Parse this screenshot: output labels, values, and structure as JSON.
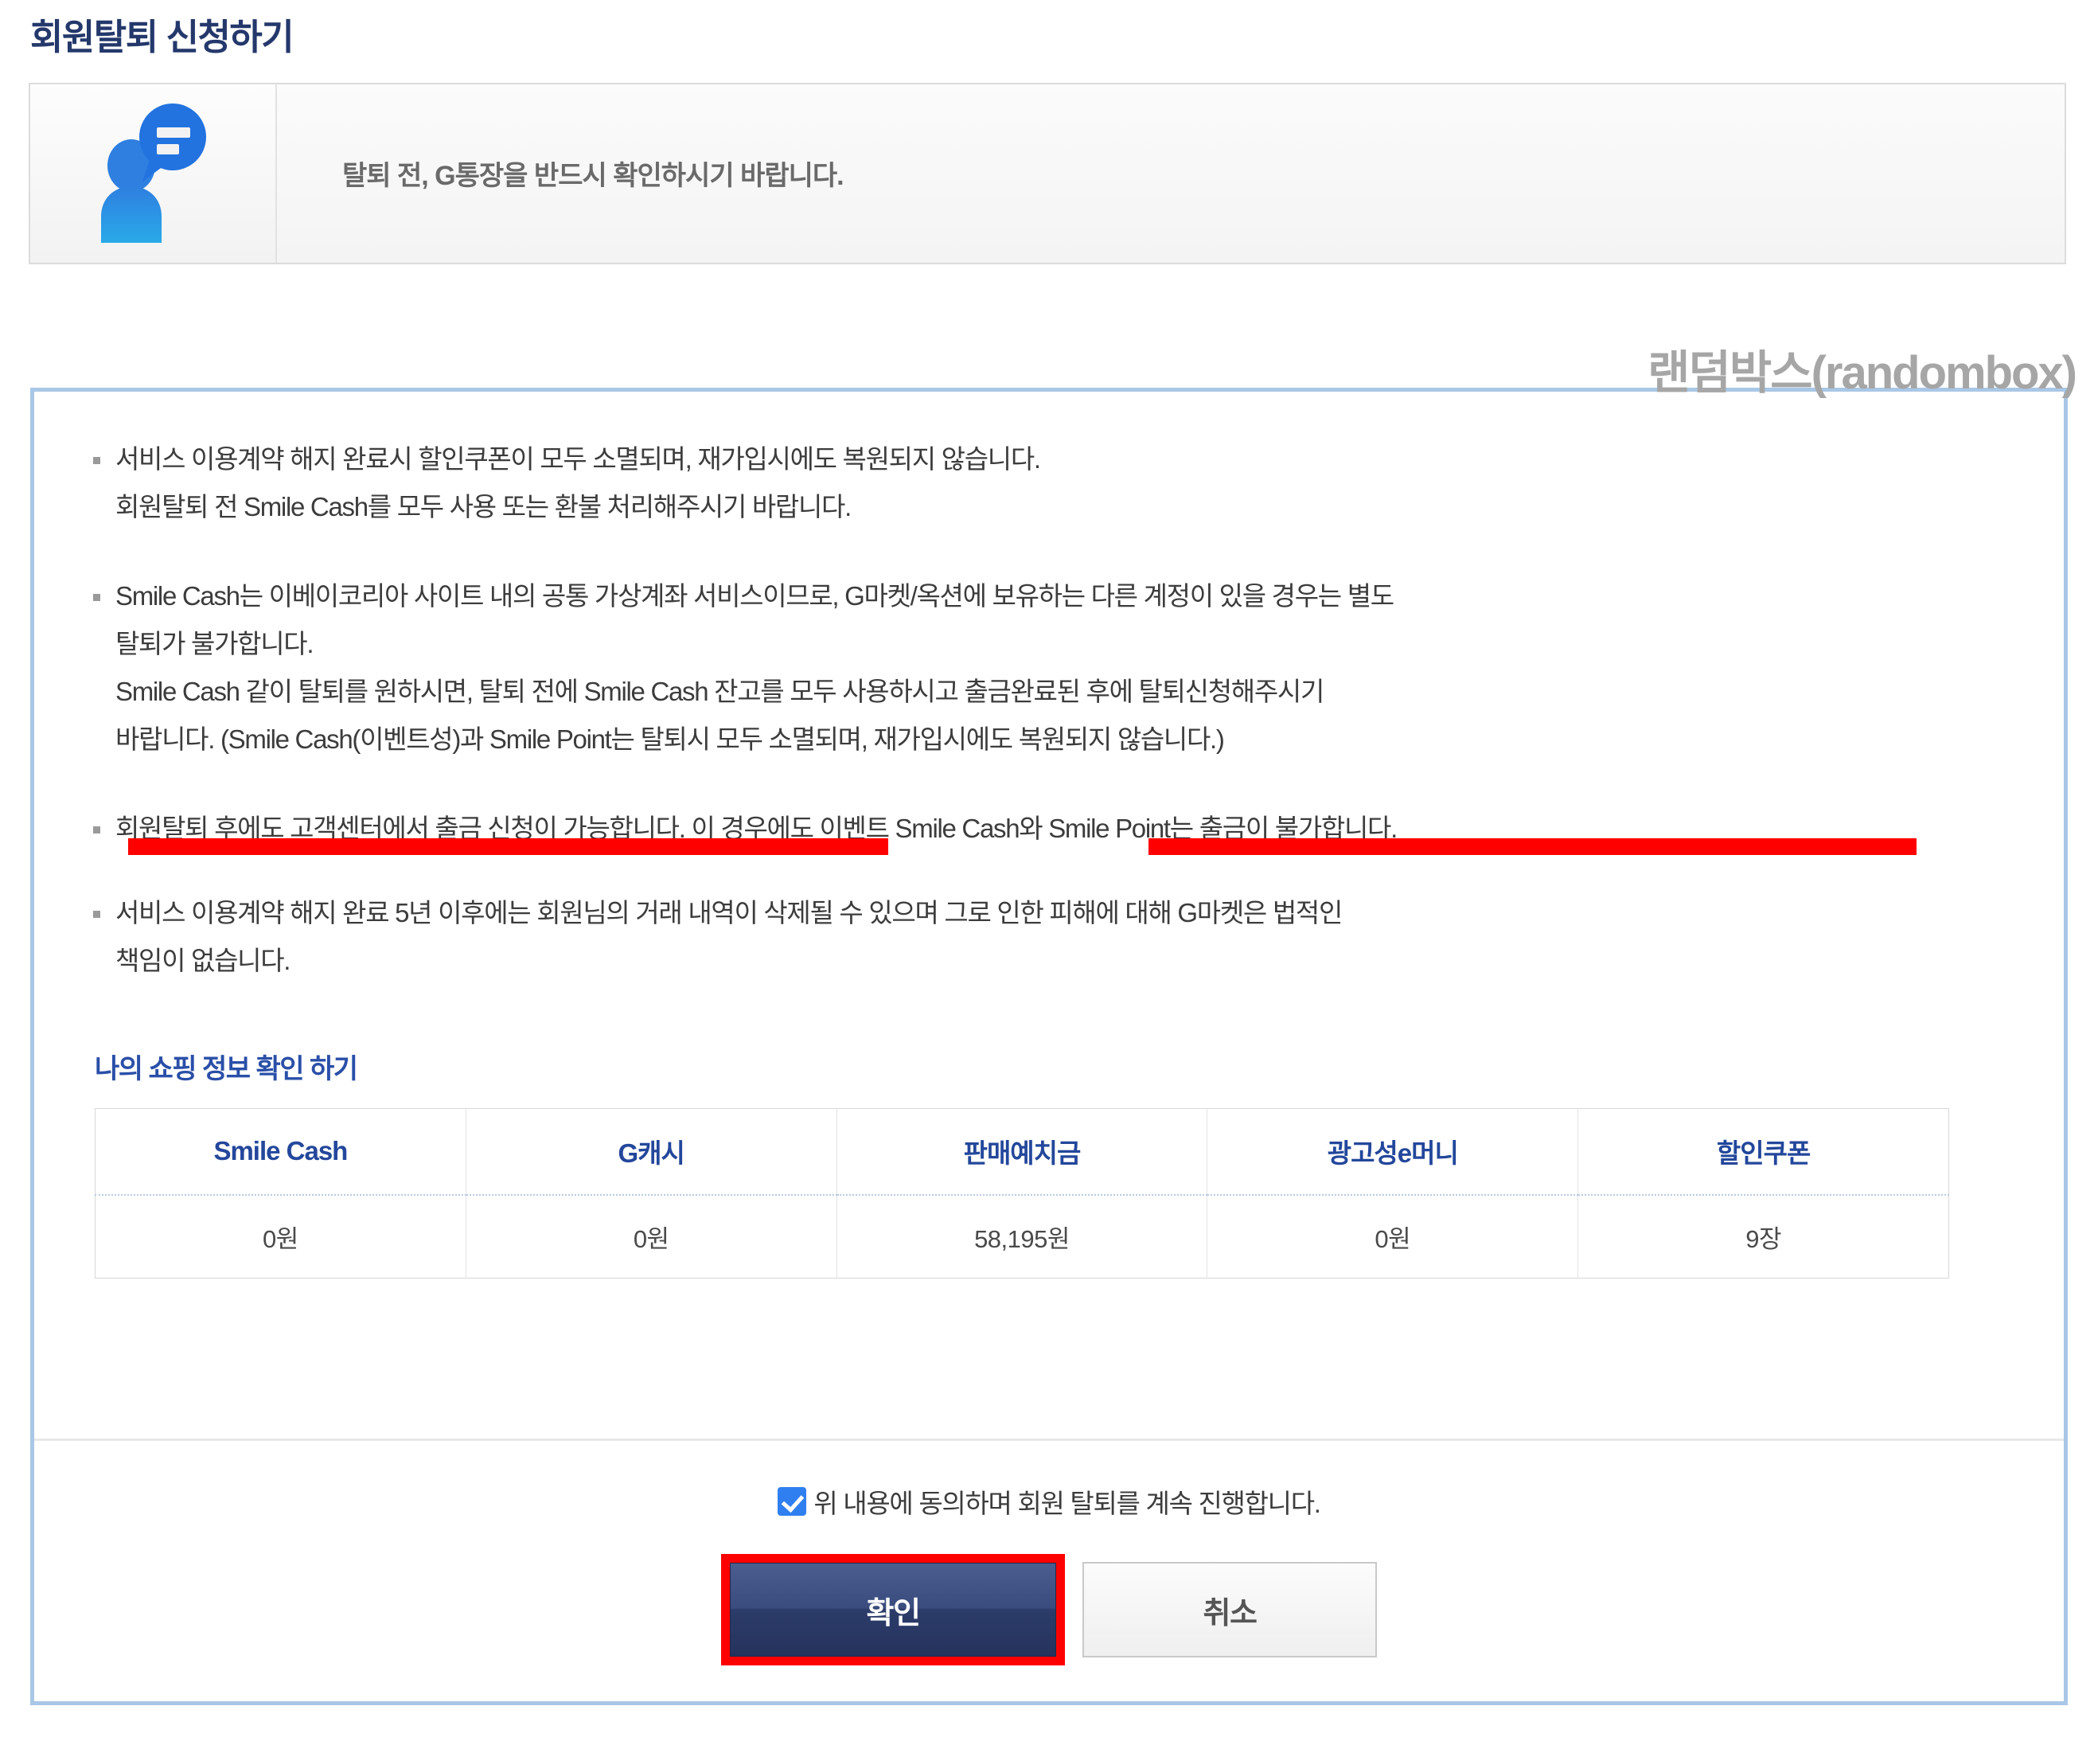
{
  "page_title": "회원탈퇴 신청하기",
  "watermark": "랜덤박스(randombox)",
  "notice": {
    "icon": "person-speech-bubble-icon",
    "text": "탈퇴 전, G통장을 반드시 확인하시기 바랍니다."
  },
  "bullets": [
    {
      "lines": [
        "서비스 이용계약 해지 완료시 할인쿠폰이 모두 소멸되며, 재가입시에도 복원되지 않습니다.",
        "회원탈퇴 전 Smile Cash를 모두 사용 또는 환불 처리해주시기 바랍니다."
      ]
    },
    {
      "lines": [
        "Smile Cash는 이베이코리아 사이트 내의 공통 가상계좌 서비스이므로, G마켓/옥션에 보유하는 다른 계정이 있을 경우는 별도",
        "탈퇴가 불가합니다.",
        "Smile Cash 같이 탈퇴를 원하시면, 탈퇴 전에 Smile Cash 잔고를 모두 사용하시고 출금완료된 후에 탈퇴신청해주시기",
        "바랍니다. (Smile Cash(이벤트성)과 Smile Point는 탈퇴시 모두 소멸되며, 재가입시에도 복원되지 않습니다.)"
      ]
    },
    {
      "lines": [
        "회원탈퇴 후에도 고객센터에서 출금 신청이 가능합니다. 이 경우에도 이벤트 Smile Cash와 Smile Point는 출금이 불가합니다."
      ],
      "highlight_color": "#fe0000"
    },
    {
      "lines": [
        "서비스 이용계약 해지 완료 5년 이후에는 회원님의 거래 내역이 삭제될 수 있으며 그로 인한 피해에 대해 G마켓은 법적인",
        "책임이 없습니다."
      ]
    }
  ],
  "shopping_info": {
    "heading": "나의 쇼핑 정보 확인 하기",
    "columns": [
      "Smile Cash",
      "G캐시",
      "판매예치금",
      "광고성e머니",
      "할인쿠폰"
    ],
    "values": [
      "0원",
      "0원",
      "58,195원",
      "0원",
      "9장"
    ]
  },
  "footer": {
    "agree_label": "위 내용에 동의하며 회원 탈퇴를 계속 진행합니다.",
    "agree_checked": true,
    "confirm_label": "확인",
    "cancel_label": "취소"
  },
  "colors": {
    "title_navy": "#24386b",
    "panel_border_blue": "#a9c7e6",
    "heading_blue": "#2a4fa8",
    "table_header_blue": "#23479b",
    "highlight_red": "#fe0000",
    "confirm_navy": "#2c3c6a",
    "checkbox_blue": "#2f7ff0",
    "watermark_gray": "#a6a6a6"
  }
}
